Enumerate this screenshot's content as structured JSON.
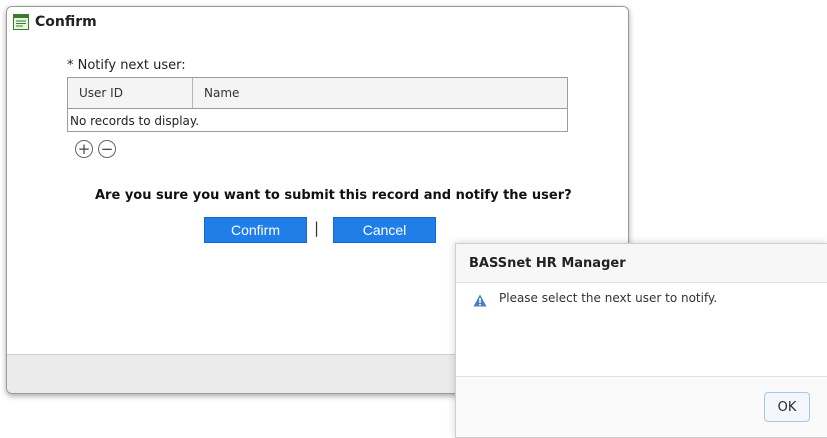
{
  "confirm_window": {
    "title": "Confirm",
    "title_icon": "form-window-icon",
    "notify_label": "* Notify next user:",
    "grid": {
      "columns": [
        "User ID",
        "Name"
      ],
      "empty_text": "No records to display."
    },
    "add_icon": "plus-circle-icon",
    "remove_icon": "minus-circle-icon",
    "add_symbol": "+",
    "remove_symbol": "−",
    "question": "Are you sure you want to submit this record and notify the user?",
    "confirm_label": "Confirm",
    "separator": "|",
    "cancel_label": "Cancel",
    "accent_color": "#1f7ee8"
  },
  "alert_dialog": {
    "title": "BASSnet HR Manager",
    "icon": "warning-icon",
    "message": "Please select the next user to notify.",
    "ok_label": "OK"
  }
}
